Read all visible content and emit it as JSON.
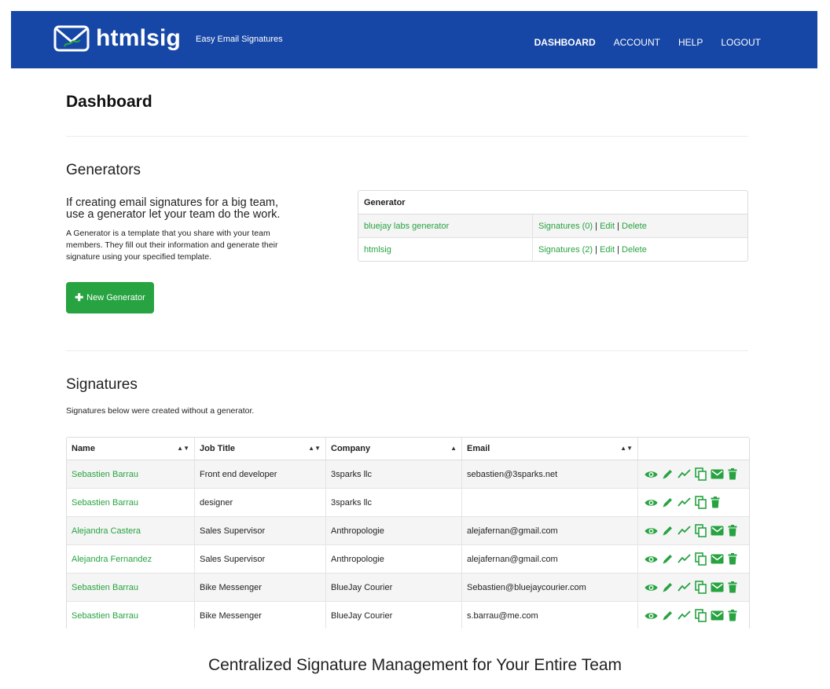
{
  "brand": {
    "name": "htmlsig",
    "tagline": "Easy Email Signatures",
    "color": "#1747a6",
    "accent": "#27a341"
  },
  "nav": [
    {
      "label": "DASHBOARD",
      "active": true
    },
    {
      "label": "ACCOUNT"
    },
    {
      "label": "HELP"
    },
    {
      "label": "LOGOUT"
    }
  ],
  "page_title": "Dashboard",
  "generators": {
    "title": "Generators",
    "lead": "If creating email signatures for a big team, use a generator let your team do the work.",
    "description": "A Generator is a template that you share with your team members. They fill out their information and generate their signature using your specified template.",
    "new_button": "New Generator",
    "table_header": "Generator",
    "rows": [
      {
        "name": "bluejay labs generator",
        "signatures": "Signatures (0)",
        "edit": "Edit",
        "delete": "Delete"
      },
      {
        "name": "htmlsig",
        "signatures": "Signatures (2)",
        "edit": "Edit",
        "delete": "Delete"
      }
    ]
  },
  "signatures": {
    "title": "Signatures",
    "description": "Signatures below were created without a generator.",
    "columns": [
      "Name",
      "Job Title",
      "Company",
      "Email"
    ],
    "rows": [
      {
        "name": "Sebastien Barrau",
        "job": "Front end developer",
        "company": "3sparks llc",
        "email": "sebastien@3sparks.net",
        "mail": true
      },
      {
        "name": "Sebastien Barrau",
        "job": "designer",
        "company": "3sparks llc",
        "email": "",
        "mail": false
      },
      {
        "name": "Alejandra Castera",
        "job": "Sales Supervisor",
        "company": "Anthropologie",
        "email": "alejafernan@gmail.com",
        "mail": true
      },
      {
        "name": "Alejandra Fernandez",
        "job": "Sales Supervisor",
        "company": "Anthropologie",
        "email": "alejafernan@gmail.com",
        "mail": true
      },
      {
        "name": "Sebastien Barrau",
        "job": "Bike Messenger",
        "company": "BlueJay Courier",
        "email": "Sebastien@bluejaycourier.com",
        "mail": true
      },
      {
        "name": "Sebastien Barrau",
        "job": "Bike Messenger",
        "company": "BlueJay Courier",
        "email": "s.barrau@me.com",
        "mail": true
      },
      {
        "name": "",
        "job": "",
        "company": "",
        "email": "",
        "mail": false
      }
    ]
  },
  "caption": "Centralized Signature Management for Your Entire Team"
}
